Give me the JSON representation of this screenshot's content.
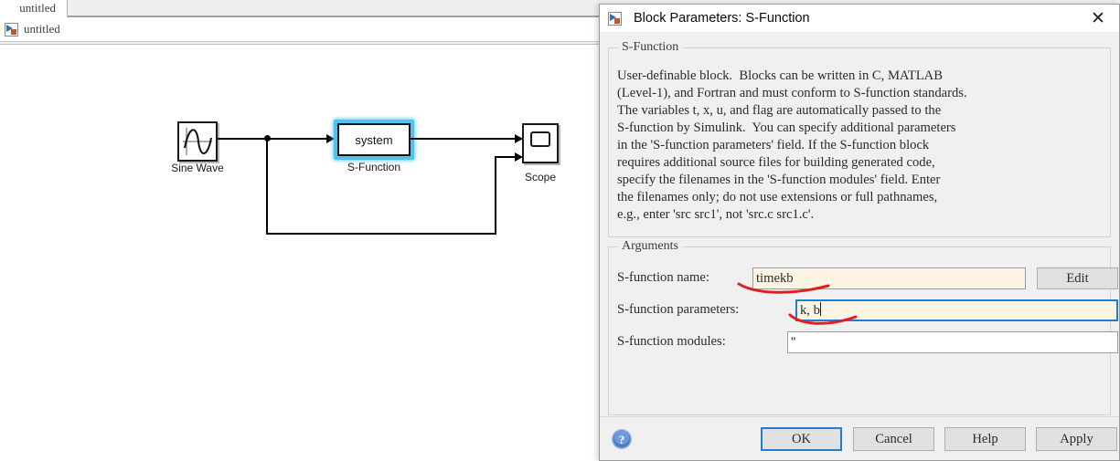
{
  "simulink": {
    "tab_label": "untitled",
    "breadcrumb_label": "untitled",
    "model_icon": "simulink-model-icon",
    "blocks": [
      {
        "name": "sine-wave",
        "label": "Sine Wave",
        "icon": "sine-wave-icon"
      },
      {
        "name": "s-function",
        "label": "S-Function",
        "inner_text": "system",
        "selected": true
      },
      {
        "name": "scope",
        "label": "Scope",
        "icon": "scope-screen-icon"
      }
    ]
  },
  "dialog": {
    "title": "Block Parameters: S-Function",
    "title_icon": "simulink-model-icon",
    "close_icon": "close-icon",
    "group_sfunction": {
      "title": "S-Function",
      "description": "User-definable block.  Blocks can be written in C, MATLAB\n(Level-1), and Fortran and must conform to S-function standards.\nThe variables t, x, u, and flag are automatically passed to the\nS-function by Simulink.  You can specify additional parameters\nin the 'S-function parameters' field. If the S-function block\nrequires additional source files for building generated code,\nspecify the filenames in the 'S-function modules' field. Enter\nthe filenames only; do not use extensions or full pathnames,\ne.g., enter 'src src1', not 'src.c src1.c'."
    },
    "group_arguments": {
      "title": "Arguments",
      "fields": [
        {
          "label": "S-function name:",
          "value": "timekb",
          "annotated": true
        },
        {
          "label": "S-function parameters:",
          "value": "k, b",
          "focused": true,
          "annotated": true
        },
        {
          "label": "S-function modules:",
          "value": "''",
          "annotated": false
        }
      ],
      "edit_button": "Edit"
    },
    "footer": {
      "help_icon": "help-circle-icon",
      "buttons": [
        {
          "label": "OK",
          "primary": true
        },
        {
          "label": "Cancel",
          "primary": false
        },
        {
          "label": "Help",
          "primary": false
        },
        {
          "label": "Apply",
          "primary": false
        }
      ]
    }
  },
  "colors": {
    "selection": "#4ec3f0",
    "focus_border": "#1c7ed6",
    "field_bg": "#fdf4e3",
    "annotation_red": "#e02020",
    "dialog_bg": "#f0f0f0"
  }
}
